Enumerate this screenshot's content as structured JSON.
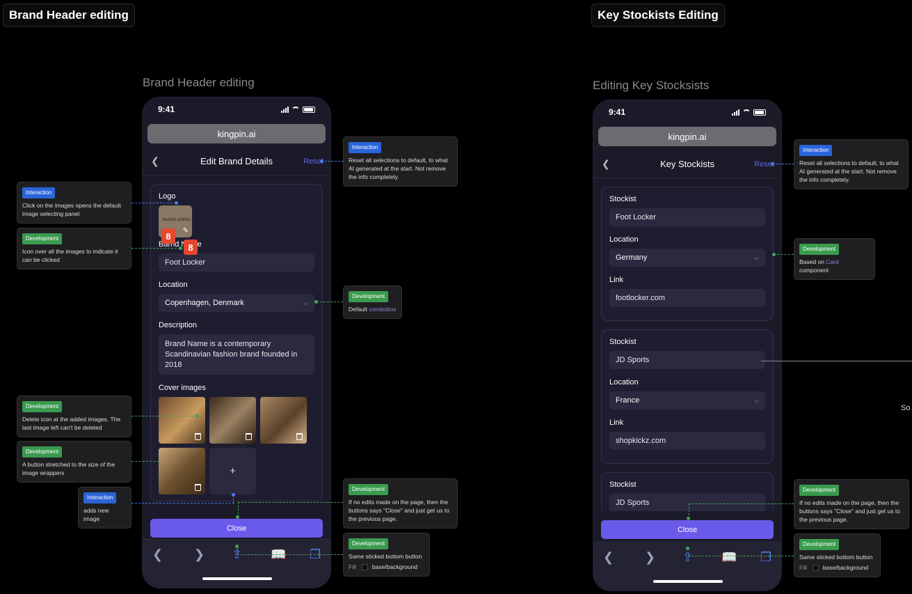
{
  "sections": {
    "left": "Brand Header editing",
    "right": "Key Stockists Editing"
  },
  "frames": {
    "left": "Brand Header editing",
    "right": "Editing Key Stocksists"
  },
  "status_time": "9:41",
  "url": "kingpin.ai",
  "left_phone": {
    "title": "Edit Brand Details",
    "reset": "Reset",
    "logo_label": "Logo",
    "logo_text": "fashion clothes",
    "badge_a": "8",
    "badge_b": "8",
    "brand_label": "Barnd Name",
    "brand_value": "Foot Locker",
    "location_label": "Location",
    "location_value": "Copenhagen, Denmark",
    "description_label": "Description",
    "description_value": "Brand Name is a contemporary Scandinavian fashion brand founded in 2018",
    "cover_label": "Cover images",
    "add_symbol": "+",
    "close": "Close"
  },
  "right_phone": {
    "title": "Key Stockists",
    "reset": "Reset",
    "stockist_label": "Stockist",
    "location_label": "Location",
    "link_label": "Link",
    "cards": [
      {
        "stockist": "Foot Locker",
        "location": "Germany",
        "link": "footlocker.com"
      },
      {
        "stockist": "JD Sports",
        "location": "France",
        "link": "shopkickz.com"
      },
      {
        "stockist": "JD Sports"
      }
    ],
    "close": "Close"
  },
  "notes": {
    "tag_interaction": "Interaction",
    "tag_development": "Development",
    "reset_text": "Reset all selections to default, to what AI generated at the start. Not remove the info completely.",
    "click_images": "Click on the images opens the default image selecting panel",
    "icon_over": "Icon over all the images to indicate it can be clicked",
    "default_prefix": "Default",
    "default_link": "combobox",
    "delete_icon": "Delete icon at the added images. The last image left can't be deleted",
    "stretched": "A button stretched to the size of the image wrappers",
    "adds_new": "adds new image",
    "no_edits": "If no edits made on the page, then the buttons says \"Close\" and just get us to the previous page.",
    "sticked": "Same sticked bottom button",
    "fill_label": "Fill",
    "fill_value": "base/background",
    "based_on_prefix": "Based on",
    "based_on_link": "Card",
    "based_on_suffix": "component"
  },
  "stray_text": "So",
  "icons": [
    "chevron-left-icon",
    "chevron-down-icon",
    "pencil-icon",
    "trash-icon",
    "share-icon",
    "book-icon",
    "tabs-icon",
    "arrow-left-icon",
    "arrow-right-icon"
  ]
}
